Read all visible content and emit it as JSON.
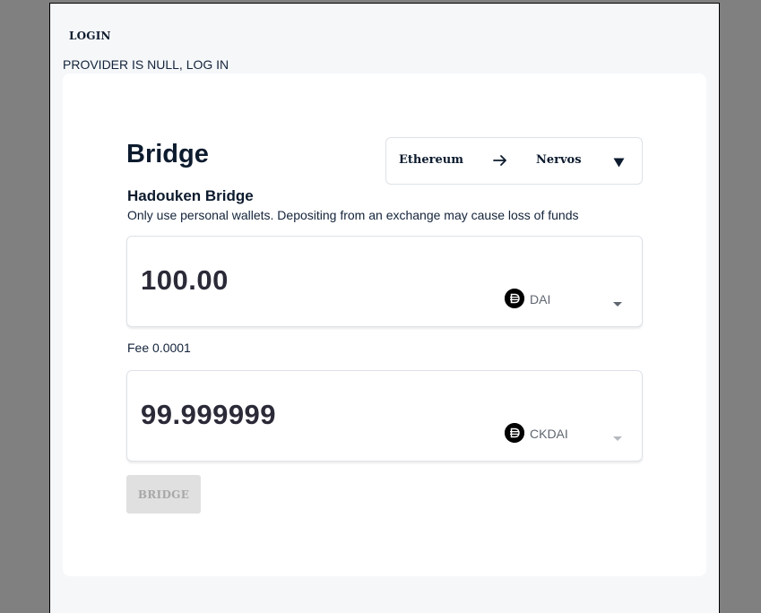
{
  "header": {
    "login_label": "LOGIN",
    "provider_message": "PROVIDER IS NULL, LOG IN"
  },
  "bridge": {
    "title": "Bridge",
    "subtitle": "Hadouken Bridge",
    "warning": "Only use personal wallets. Depositing from an exchange may cause loss of funds",
    "network": {
      "from": "Ethereum",
      "to": "Nervos",
      "arrow_icon": "arrow-right-icon",
      "caret_icon": "triangle-down-icon"
    },
    "from_amount": {
      "value": "100.00",
      "token": "DAI",
      "token_icon": "dai-icon"
    },
    "fee_text": "Fee 0.0001",
    "to_amount": {
      "value": "99.999999",
      "token": "CKDAI",
      "token_icon": "dai-icon"
    },
    "submit_label": "BRIDGE",
    "submit_disabled": true
  },
  "colors": {
    "background": "#808080",
    "page": "#f5f7f9",
    "card": "#ffffff",
    "text_dark": "#0d1b2e",
    "disabled_button": "#e0e0e0",
    "disabled_text": "#a8a8a8"
  }
}
